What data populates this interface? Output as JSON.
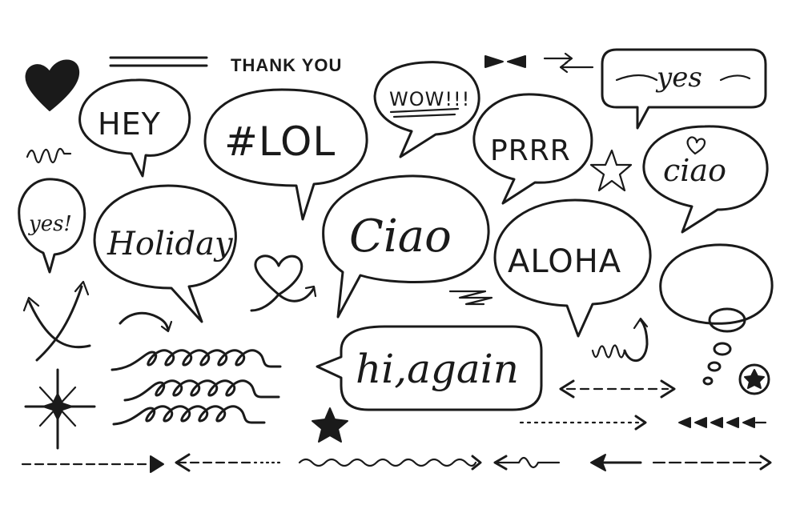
{
  "background_color": "#ffffff",
  "ink_color": "#1a1a1a",
  "labels": {
    "thank_you": "THANK YOU",
    "hey": "HEY",
    "lol": "#LOL",
    "wow": "WOW!!!",
    "prrr": "PRRR",
    "yes_top": "yes",
    "ciao_small": "ciao",
    "yes_left": "yes!",
    "holiday": "Holiday",
    "ciao_big": "Ciao",
    "aloha": "ALOHA",
    "hi_again": "hi,again"
  },
  "icons": [
    "heart-icon",
    "heart-loop-icon",
    "star-outline-icon",
    "star-filled-icon",
    "star-circle-icon",
    "double-line-decoration",
    "double-arrowheads-icon",
    "swap-arrows-icon",
    "squiggle-decoration",
    "crossed-arrows-icon",
    "sparkle-burst-icon",
    "curved-arrow-icon",
    "loop-waves-decoration",
    "dashed-arrow-icon",
    "dotted-arrow-icon",
    "chevron-arrows-icon",
    "zigzag-decoration",
    "thought-bubble-icon"
  ]
}
